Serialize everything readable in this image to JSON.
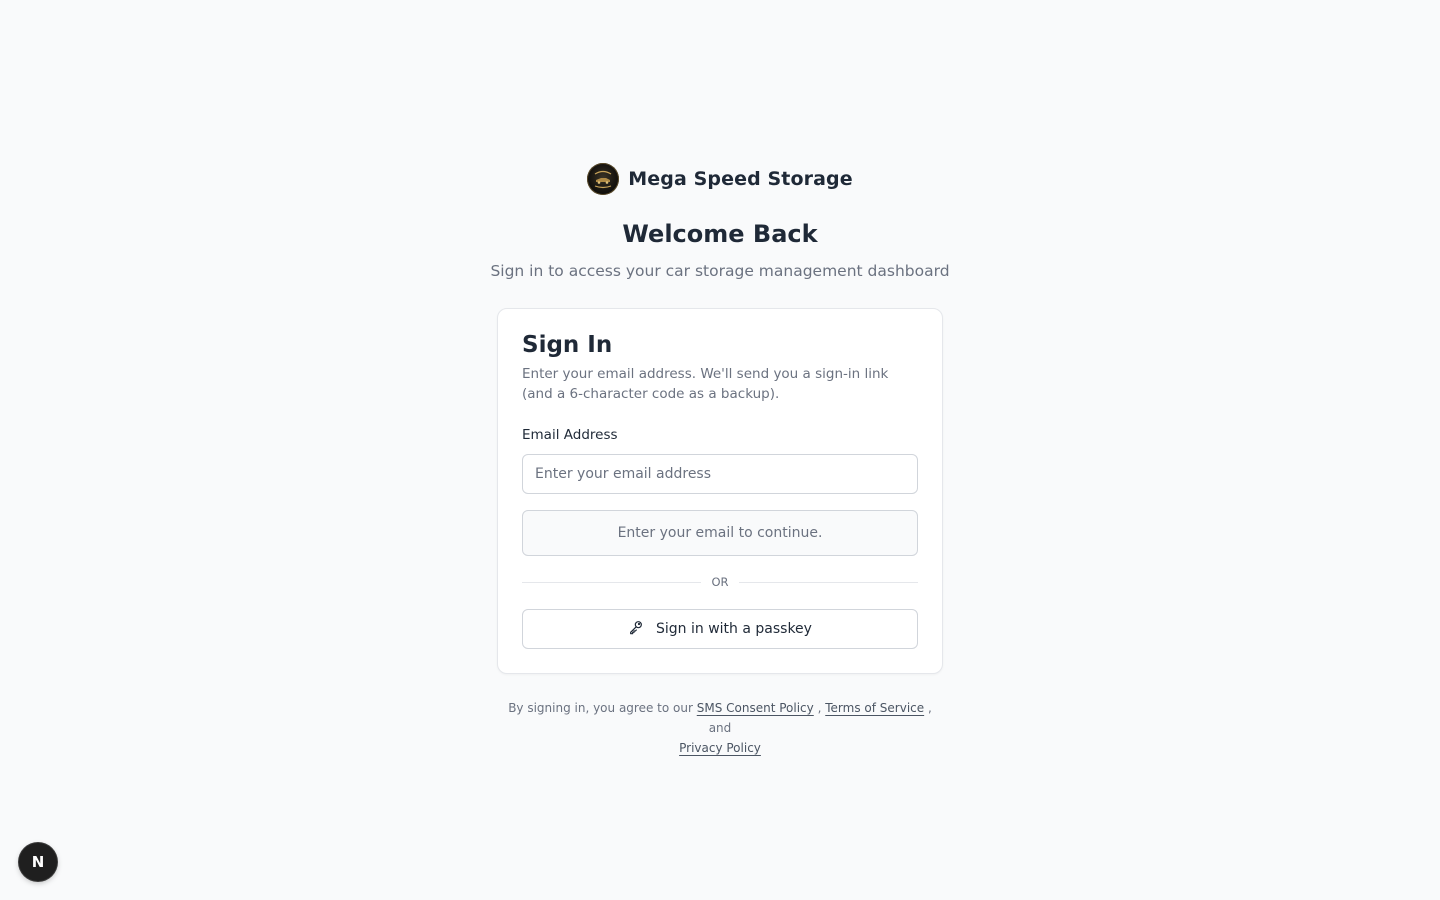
{
  "brand": {
    "name": "Mega Speed Storage",
    "logo_icon": "mega-speed-storage-logo"
  },
  "header": {
    "title": "Welcome Back",
    "subtitle": "Sign in to access your car storage management dashboard"
  },
  "signin_card": {
    "title": "Sign In",
    "description": "Enter your email address. We'll send you a sign-in link (and a 6-character code as a backup).",
    "email_label": "Email Address",
    "email_placeholder": "Enter your email address",
    "email_value": "",
    "continue_label": "Enter your email to continue.",
    "divider_text": "OR",
    "passkey_label": "Sign in with a passkey",
    "passkey_icon": "key-icon"
  },
  "legal": {
    "prefix": "By signing in, you agree to our",
    "sms_link": "SMS Consent Policy",
    "sep1": ",",
    "terms_link": "Terms of Service",
    "sep2": ", and",
    "privacy_link": "Privacy Policy"
  },
  "dev_badge": {
    "letter": "N"
  }
}
